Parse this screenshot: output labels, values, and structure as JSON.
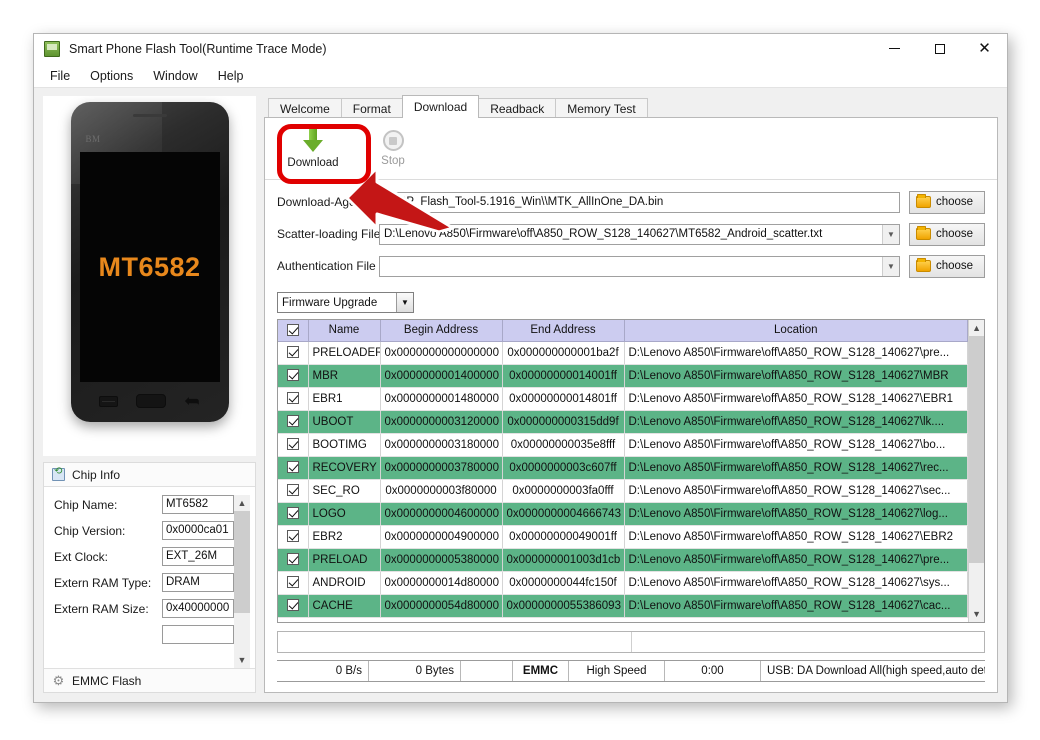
{
  "window": {
    "title": "Smart Phone Flash Tool(Runtime Trace Mode)",
    "icon": "flash-tool-icon",
    "minimize": "—",
    "maximize": "□",
    "close": "✕"
  },
  "menu": {
    "items": [
      {
        "label": "File"
      },
      {
        "label": "Options"
      },
      {
        "label": "Window"
      },
      {
        "label": "Help"
      }
    ]
  },
  "phone_preview": {
    "brand": "BM",
    "screen_label": "MT6582",
    "keys": [
      "menu-key",
      "home-key",
      "back-key"
    ]
  },
  "chip_info": {
    "header": "Chip Info",
    "fields": [
      {
        "label": "Chip Name:",
        "value": "MT6582"
      },
      {
        "label": "Chip Version:",
        "value": "0x0000ca01"
      },
      {
        "label": "Ext Clock:",
        "value": "EXT_26M"
      },
      {
        "label": "Extern RAM Type:",
        "value": "DRAM"
      },
      {
        "label": "Extern RAM Size:",
        "value": "0x40000000"
      }
    ]
  },
  "emmc_flash": {
    "header": "EMMC Flash"
  },
  "tabs": [
    {
      "label": "Welcome",
      "active": false
    },
    {
      "label": "Format",
      "active": false
    },
    {
      "label": "Download",
      "active": true
    },
    {
      "label": "Readback",
      "active": false
    },
    {
      "label": "Memory Test",
      "active": false
    }
  ],
  "toolbar": {
    "download_label": "Download",
    "download_icon": "download-arrow-icon",
    "stop_label": "Stop",
    "stop_icon": "stop-circle-icon",
    "highlight_color": "#e00000"
  },
  "file_fields": [
    {
      "label": "Download-Agent",
      "value": "C:\\SP_Flash_Tool-5.1916_Win\\\\MTK_AllInOne_DA.bin",
      "combo": false,
      "choose": "choose"
    },
    {
      "label": "Scatter-loading File",
      "value": "D:\\Lenovo A850\\Firmware\\off\\A850_ROW_S128_140627\\MT6582_Android_scatter.txt",
      "combo": true,
      "choose": "choose"
    },
    {
      "label": "Authentication File",
      "value": "",
      "combo": true,
      "choose": "choose"
    }
  ],
  "mode_select": {
    "selected": "Firmware Upgrade"
  },
  "partition_table": {
    "columns": [
      "",
      "Name",
      "Begin Address",
      "End Address",
      "Location"
    ],
    "header_checkbox_checked": true,
    "rows": [
      {
        "checked": true,
        "name": "PRELOADER",
        "begin": "0x0000000000000000",
        "end": "0x000000000001ba2f",
        "location": "D:\\Lenovo A850\\Firmware\\off\\A850_ROW_S128_140627\\pre...",
        "highlight": false
      },
      {
        "checked": true,
        "name": "MBR",
        "begin": "0x0000000001400000",
        "end": "0x00000000014001ff",
        "location": "D:\\Lenovo A850\\Firmware\\off\\A850_ROW_S128_140627\\MBR",
        "highlight": true
      },
      {
        "checked": true,
        "name": "EBR1",
        "begin": "0x0000000001480000",
        "end": "0x00000000014801ff",
        "location": "D:\\Lenovo A850\\Firmware\\off\\A850_ROW_S128_140627\\EBR1",
        "highlight": false
      },
      {
        "checked": true,
        "name": "UBOOT",
        "begin": "0x0000000003120000",
        "end": "0x000000000315dd9f",
        "location": "D:\\Lenovo A850\\Firmware\\off\\A850_ROW_S128_140627\\lk....",
        "highlight": true
      },
      {
        "checked": true,
        "name": "BOOTIMG",
        "begin": "0x0000000003180000",
        "end": "0x00000000035e8fff",
        "location": "D:\\Lenovo A850\\Firmware\\off\\A850_ROW_S128_140627\\bo...",
        "highlight": false
      },
      {
        "checked": true,
        "name": "RECOVERY",
        "begin": "0x0000000003780000",
        "end": "0x0000000003c607ff",
        "location": "D:\\Lenovo A850\\Firmware\\off\\A850_ROW_S128_140627\\rec...",
        "highlight": true
      },
      {
        "checked": true,
        "name": "SEC_RO",
        "begin": "0x0000000003f80000",
        "end": "0x0000000003fa0fff",
        "location": "D:\\Lenovo A850\\Firmware\\off\\A850_ROW_S128_140627\\sec...",
        "highlight": false
      },
      {
        "checked": true,
        "name": "LOGO",
        "begin": "0x0000000004600000",
        "end": "0x0000000004666743",
        "location": "D:\\Lenovo A850\\Firmware\\off\\A850_ROW_S128_140627\\log...",
        "highlight": true
      },
      {
        "checked": true,
        "name": "EBR2",
        "begin": "0x0000000004900000",
        "end": "0x00000000049001ff",
        "location": "D:\\Lenovo A850\\Firmware\\off\\A850_ROW_S128_140627\\EBR2",
        "highlight": false
      },
      {
        "checked": true,
        "name": "PRELOAD",
        "begin": "0x0000000005380000",
        "end": "0x000000001003d1cb",
        "location": "D:\\Lenovo A850\\Firmware\\off\\A850_ROW_S128_140627\\pre...",
        "highlight": true
      },
      {
        "checked": true,
        "name": "ANDROID",
        "begin": "0x0000000014d80000",
        "end": "0x0000000044fc150f",
        "location": "D:\\Lenovo A850\\Firmware\\off\\A850_ROW_S128_140627\\sys...",
        "highlight": false
      },
      {
        "checked": true,
        "name": "CACHE",
        "begin": "0x0000000054d80000",
        "end": "0x0000000055386093",
        "location": "D:\\Lenovo A850\\Firmware\\off\\A850_ROW_S128_140627\\cac...",
        "highlight": true
      }
    ],
    "highlight_color": "#5cb487",
    "header_color": "#ccccf0"
  },
  "status_bar": {
    "speed": "0 B/s",
    "bytes": "0 Bytes",
    "blank": "",
    "storage": "EMMC",
    "usb_speed": "High Speed",
    "elapsed": "0:00",
    "message": "USB: DA Download All(high speed,auto detect)"
  }
}
